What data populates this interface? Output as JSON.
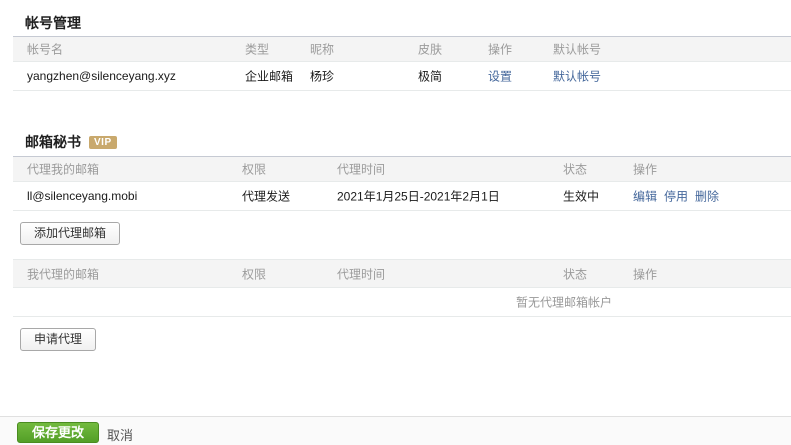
{
  "colors": {
    "link": "#44679b",
    "vip_badge": "#c9a96d",
    "save_green": "#539f27"
  },
  "account_section": {
    "title": "帐号管理",
    "headers": [
      "帐号名",
      "类型",
      "昵称",
      "皮肤",
      "操作",
      "默认帐号"
    ],
    "row": {
      "account": "yangzhen@silenceyang.xyz",
      "type": "企业邮箱",
      "nickname": "杨珍",
      "skin": "极简",
      "settings_link": "设置",
      "default_link": "默认帐号"
    }
  },
  "secretary_section": {
    "title": "邮箱秘书",
    "vip_badge": "VIP",
    "delegated_to_me": {
      "headers": [
        "代理我的邮箱",
        "权限",
        "代理时间",
        "状态",
        "操作"
      ],
      "row": {
        "email": "ll@silenceyang.mobi",
        "permission": "代理发送",
        "period": "2021年1月25日-2021年2月1日",
        "status": "生效中",
        "actions": [
          "编辑",
          "停用",
          "删除"
        ]
      },
      "add_button": "添加代理邮箱"
    },
    "delegated_by_me": {
      "headers": [
        "我代理的邮箱",
        "权限",
        "代理时间",
        "状态",
        "操作"
      ],
      "empty_text": "暂无代理邮箱帐户",
      "apply_button": "申请代理"
    }
  },
  "footer": {
    "save_button": "保存更改",
    "cancel_button": "取消"
  }
}
